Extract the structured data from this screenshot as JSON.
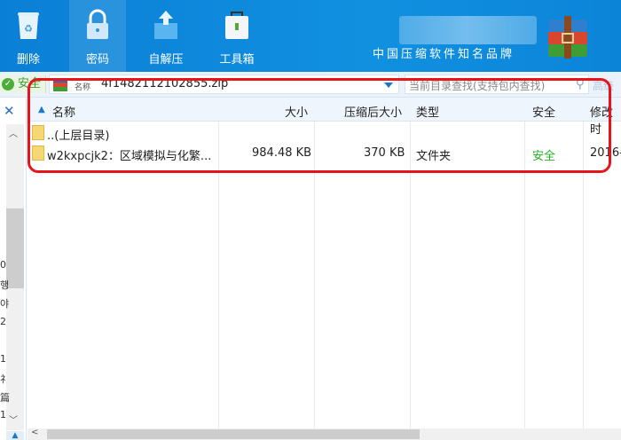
{
  "toolbar": {
    "buttons": [
      {
        "label": "删除",
        "icon": "recycle-bin-icon"
      },
      {
        "label": "密码",
        "icon": "lock-icon"
      },
      {
        "label": "自解压",
        "icon": "box-upload-icon"
      },
      {
        "label": "工具箱",
        "icon": "toolbox-icon"
      }
    ],
    "slogan": "中国压缩软件知名品牌"
  },
  "address": {
    "safe_label": "安全",
    "path": "4f1482112102855.zip",
    "overlay": "名称",
    "search_placeholder": "当前目录查找(支持包内查找)",
    "advanced": "高级"
  },
  "columns": [
    "名称",
    "大小",
    "压缩后大小",
    "类型",
    "安全",
    "修改时"
  ],
  "rows": [
    {
      "name": "..(上层目录)",
      "size": "",
      "packed": "",
      "type": "",
      "security": "",
      "modified": ""
    },
    {
      "name": "w2kxpcjk2：区域模拟与化繁...",
      "size": "984.48 KB",
      "packed": "370 KB",
      "type": "文件夹",
      "security": "安全",
      "modified": "2016-"
    }
  ],
  "side_chars": [
    "0",
    "행",
    "야",
    "2",
    "1",
    "礻",
    "篇",
    "1"
  ],
  "colors": {
    "accent": "#0b84d8",
    "safe": "#22b022",
    "highlight": "#e8141c"
  }
}
